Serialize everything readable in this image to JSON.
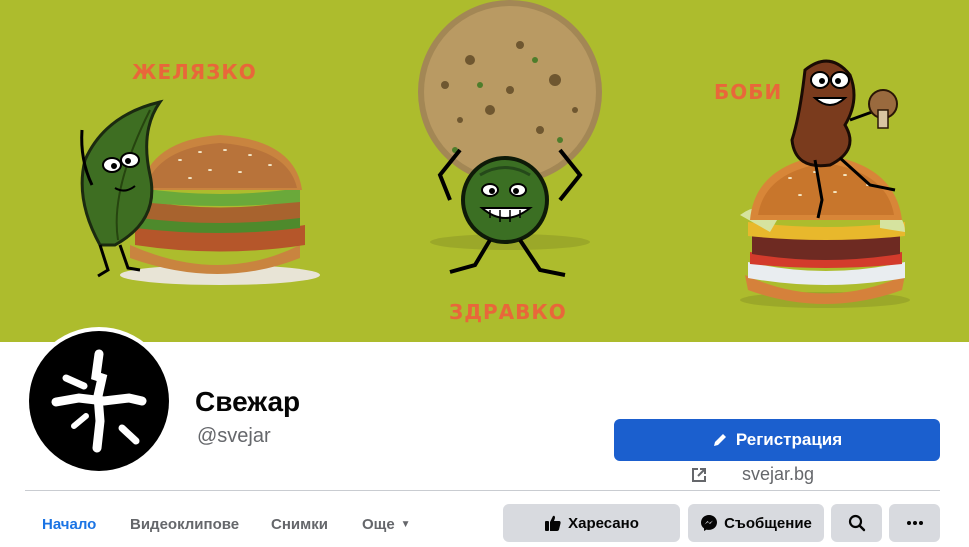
{
  "cover": {
    "labels": {
      "left": "ЖЕЛЯЗКО",
      "center": "ЗДРАВКО",
      "right": "БОБИ"
    },
    "background_color": "#adbc2d",
    "label_color": "#e8673a"
  },
  "profile": {
    "name": "Свежар",
    "handle": "@svejar"
  },
  "actions": {
    "register_label": "Регистрация",
    "website": "svejar.bg",
    "like_label": "Харесано",
    "message_label": "Съобщение"
  },
  "tabs": [
    {
      "label": "Начало",
      "active": true
    },
    {
      "label": "Видеоклипове",
      "active": false
    },
    {
      "label": "Снимки",
      "active": false
    },
    {
      "label": "Още",
      "active": false
    }
  ],
  "colors": {
    "primary": "#1b5fce",
    "tab_active": "#1b74e4",
    "secondary_button": "#d8dadf"
  },
  "icons": [
    "pencil-icon",
    "external-link-icon",
    "thumbs-up-icon",
    "messenger-icon",
    "search-icon",
    "more-dots-icon",
    "caret-down-icon"
  ]
}
